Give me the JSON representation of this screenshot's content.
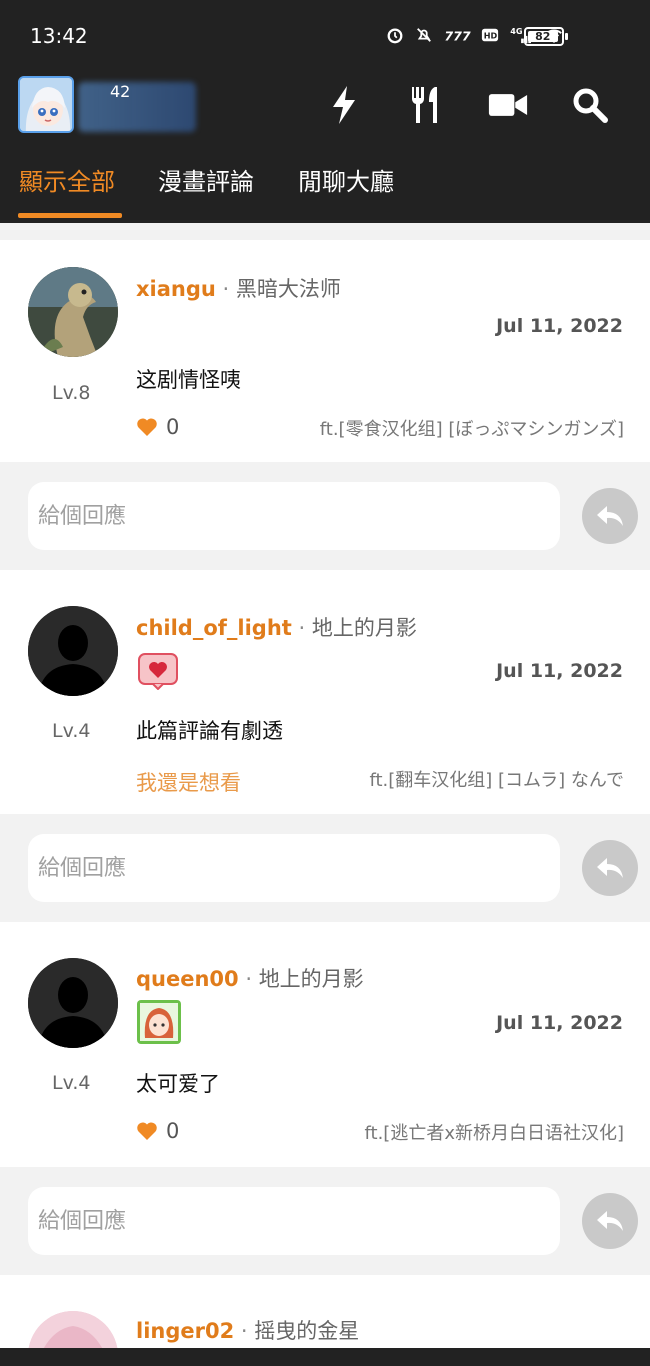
{
  "status_bar": {
    "time": "13:42",
    "battery": "82",
    "icons": [
      "alarm-icon",
      "mute-icon",
      "network-speed-icon",
      "hd-icon",
      "signal-4g-icon",
      "wifi-icon"
    ]
  },
  "header": {
    "my_level_badge": "42",
    "actions": [
      "flash-icon",
      "food-icon",
      "video-icon",
      "search-icon"
    ],
    "accent_color": "#f08a24"
  },
  "tabs": [
    {
      "label": "顯示全部",
      "active": true
    },
    {
      "label": "漫畫評論",
      "active": false
    },
    {
      "label": "閒聊大廳",
      "active": false
    }
  ],
  "reply_placeholder": "給個回應",
  "comments": [
    {
      "username": "xiangu",
      "title": "黑暗大法师",
      "level": "Lv.8",
      "date": "Jul 11, 2022",
      "text": "这剧情怪咦",
      "likes": "0",
      "source": "ft.[零食汉化组] [ぼっぷマシンガンズ]"
    },
    {
      "username": "child_of_light",
      "title": "地上的月影",
      "level": "Lv.4",
      "date": "Jul 11, 2022",
      "text": "此篇評論有劇透",
      "spoiler_link": "我還是想看",
      "source": "ft.[翻车汉化组] [コムラ] なんで"
    },
    {
      "username": "queen00",
      "title": "地上的月影",
      "level": "Lv.4",
      "date": "Jul 11, 2022",
      "text": "太可爱了",
      "likes": "0",
      "source": "ft.[逃亡者x新桥月白日语社汉化]"
    },
    {
      "username": "linger02",
      "title": "摇曳的金星"
    }
  ]
}
